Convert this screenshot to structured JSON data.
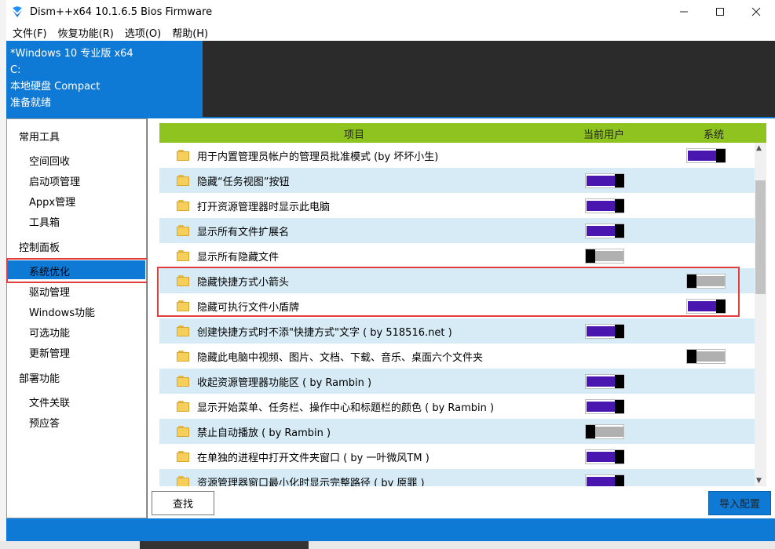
{
  "window": {
    "title": "Dism++x64 10.1.6.5 Bios Firmware"
  },
  "menubar": [
    "文件(F)",
    "恢复功能(R)",
    "选项(O)",
    "帮助(H)"
  ],
  "info": {
    "os": "*Windows 10 专业版 x64",
    "drive": "C:",
    "disk": "本地硬盘 Compact",
    "status": "准备就绪"
  },
  "sidebar": {
    "groups": [
      {
        "label": "常用工具",
        "items": [
          "空间回收",
          "启动项管理",
          "Appx管理",
          "工具箱"
        ]
      },
      {
        "label": "控制面板",
        "items": [
          "系统优化",
          "驱动管理",
          "Windows功能",
          "可选功能",
          "更新管理"
        ]
      },
      {
        "label": "部署功能",
        "items": [
          "文件关联",
          "预应答"
        ]
      }
    ],
    "selected": "系统优化"
  },
  "grid": {
    "headers": {
      "item": "项目",
      "user": "当前用户",
      "system": "系统"
    },
    "rows": [
      {
        "label": "用于内置管理员帐户的管理员批准模式 (by 坏坏小生)",
        "user": null,
        "system": "on"
      },
      {
        "label": "隐藏“任务视图”按钮",
        "user": "on",
        "system": null
      },
      {
        "label": "打开资源管理器时显示此电脑",
        "user": "on",
        "system": null
      },
      {
        "label": "显示所有文件扩展名",
        "user": "on",
        "system": null
      },
      {
        "label": "显示所有隐藏文件",
        "user": "off",
        "system": null
      },
      {
        "label": "隐藏快捷方式小箭头",
        "user": null,
        "system": "off"
      },
      {
        "label": "隐藏可执行文件小盾牌",
        "user": null,
        "system": "on"
      },
      {
        "label": "创建快捷方式时不添\"快捷方式\"文字 ( by 518516.net )",
        "user": "on",
        "system": null
      },
      {
        "label": "隐藏此电脑中视频、图片、文档、下载、音乐、桌面六个文件夹",
        "user": null,
        "system": "off"
      },
      {
        "label": "收起资源管理器功能区 ( by Rambin )",
        "user": "on",
        "system": null
      },
      {
        "label": "显示开始菜单、任务栏、操作中心和标题栏的颜色 ( by Rambin )",
        "user": "on",
        "system": null
      },
      {
        "label": "禁止自动播放 ( by Rambin )",
        "user": "off",
        "system": null
      },
      {
        "label": "在单独的进程中打开文件夹窗口 ( by 一叶微风TM )",
        "user": "on",
        "system": null
      },
      {
        "label": "资源管理器窗口最小化时显示完整路径 ( by 原罪 )",
        "user": "on",
        "system": null
      }
    ]
  },
  "buttons": {
    "find": "查找",
    "import": "导入配置"
  },
  "colors": {
    "accent": "#0f7ad5",
    "header": "#8fc31f",
    "toggle_on": "#4a16b0",
    "highlight_box": "#e23c3c"
  }
}
